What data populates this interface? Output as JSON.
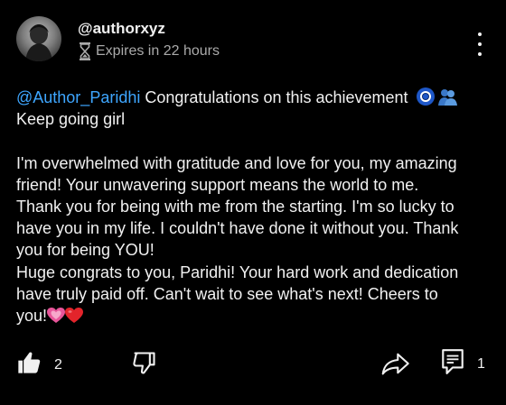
{
  "post": {
    "author": "@authorxyz",
    "expires_text": "Expires in 22 hours",
    "mention": "@Author_Paridhi",
    "line1_rest": " Congratulations on this achievement ",
    "line2": "Keep going girl",
    "paragraph_lines": [
      "I'm overwhelmed with gratitude and love for you, my amazing",
      "friend! Your unwavering support means the world to me.",
      "Thank you for being with me from the starting. I'm so lucky to",
      "have you in my life.  I couldn't have done it without you. Thank",
      "you for being YOU!",
      "Huge congrats to you, Paridhi!  Your hard work and dedication",
      "have truly paid off. Can't wait to see what's next! Cheers to",
      "you!"
    ]
  },
  "actions": {
    "like_count": "2",
    "comment_count": "1"
  },
  "icons": {
    "avatar": "profile-photo",
    "expires": "hourglass-icon",
    "menu": "more-vertical-icon",
    "like": "thumbs-up-icon",
    "dislike": "thumbs-down-icon",
    "share": "share-arrow-icon",
    "comment": "comment-icon",
    "emoji_1": "nazar-amulet-emoji",
    "emoji_2": "people-hugging-emoji",
    "emoji_3": "growing-heart-emoji",
    "emoji_4": "red-heart-emoji"
  },
  "colors": {
    "background": "#000000",
    "text": "#f1f1f1",
    "secondary_text": "#aaaaaa",
    "mention": "#3ea6ff"
  }
}
